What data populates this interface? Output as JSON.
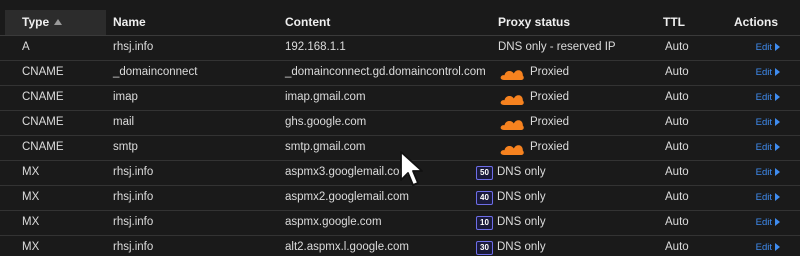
{
  "table": {
    "headers": {
      "type": "Type",
      "name": "Name",
      "content": "Content",
      "proxy": "Proxy status",
      "ttl": "TTL",
      "actions": "Actions"
    },
    "rows": [
      {
        "type": "A",
        "name": "rhsj.info",
        "content": "192.168.1.1",
        "proxy": "DNS only - reserved IP",
        "ttl": "Auto",
        "action": "Edit"
      },
      {
        "type": "CNAME",
        "name": "_domainconnect",
        "content": "_domainconnect.gd.domaincontrol.com",
        "proxy": "Proxied",
        "ttl": "Auto",
        "action": "Edit"
      },
      {
        "type": "CNAME",
        "name": "imap",
        "content": "imap.gmail.com",
        "proxy": "Proxied",
        "ttl": "Auto",
        "action": "Edit"
      },
      {
        "type": "CNAME",
        "name": "mail",
        "content": "ghs.google.com",
        "proxy": "Proxied",
        "ttl": "Auto",
        "action": "Edit"
      },
      {
        "type": "CNAME",
        "name": "smtp",
        "content": "smtp.gmail.com",
        "proxy": "Proxied",
        "ttl": "Auto",
        "action": "Edit"
      },
      {
        "type": "MX",
        "name": "rhsj.info",
        "content": "aspmx3.googlemail.com",
        "priority": "50",
        "proxy": "DNS only",
        "ttl": "Auto",
        "action": "Edit"
      },
      {
        "type": "MX",
        "name": "rhsj.info",
        "content": "aspmx2.googlemail.com",
        "priority": "40",
        "proxy": "DNS only",
        "ttl": "Auto",
        "action": "Edit"
      },
      {
        "type": "MX",
        "name": "rhsj.info",
        "content": "aspmx.google.com",
        "priority": "10",
        "proxy": "DNS only",
        "ttl": "Auto",
        "action": "Edit"
      },
      {
        "type": "MX",
        "name": "rhsj.info",
        "content": "alt2.aspmx.l.google.com",
        "priority": "30",
        "proxy": "DNS only",
        "ttl": "Auto",
        "action": "Edit"
      }
    ]
  },
  "colors": {
    "background": "#1a1a1a",
    "link": "#3f8cf0",
    "cloud": "#f6821f",
    "priority_border": "#6d6de8"
  },
  "icons": {
    "sort": "sort-ascending-icon",
    "proxied": "orange-cloud-icon",
    "edit": "caret-right-icon",
    "cursor": "mouse-pointer-icon"
  }
}
